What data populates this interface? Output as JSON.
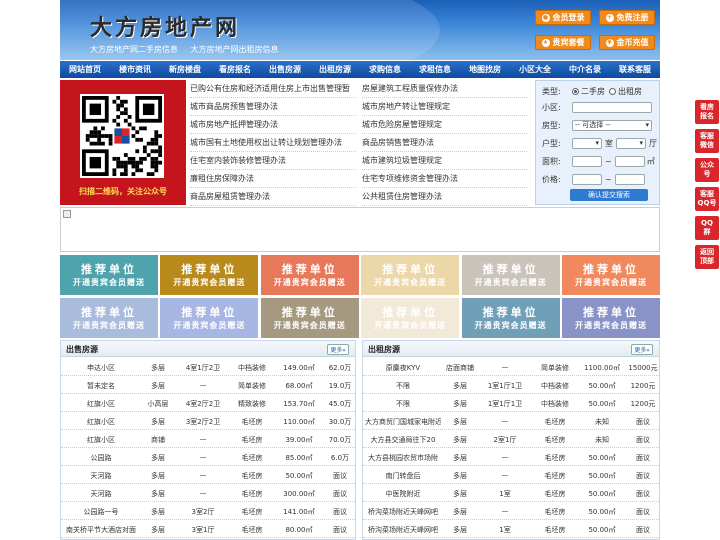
{
  "header": {
    "logo": "大方房地产网",
    "taglines": [
      "大方房地产网二手房信息",
      "大方房地产网出租房信息"
    ],
    "buttons": [
      "会员登录",
      "免费注册",
      "贵宾套餐",
      "金币充值"
    ]
  },
  "nav": [
    "网站首页",
    "楼市资讯",
    "新房楼盘",
    "看房报名",
    "出售房源",
    "出租房源",
    "求购信息",
    "求租信息",
    "地图找房",
    "小区大全",
    "中介名录",
    "联系客服"
  ],
  "qr": {
    "caption": "扫描二维码，关注公众号"
  },
  "links": {
    "left": [
      "已购公有住房和经济适用住房上市出售管理暂",
      "城市商品房预售管理办法",
      "城市房地产抵押管理办法",
      "城市国有土地使用权出让转让规划管理办法",
      "住宅室内装饰装修管理办法",
      "廉租住房保障办法",
      "商品房屋租赁管理办法"
    ],
    "right": [
      "房屋建筑工程质量保修办法",
      "城市房地产转让管理规定",
      "城市危险房屋管理规定",
      "商品房销售管理办法",
      "城市建筑垃圾管理规定",
      "住宅专项维修资金管理办法",
      "公共租赁住房管理办法"
    ]
  },
  "search": {
    "type_label": "类型:",
    "type_options": [
      "二手房",
      "出租房"
    ],
    "community_label": "小区:",
    "house_type_label": "房型:",
    "house_type_value": "-- 可选择 --",
    "layout_label": "户型:",
    "room_unit": "室",
    "hall_unit": "厅",
    "area_label": "面积:",
    "area_unit": "㎡",
    "price_label": "价格:",
    "range_sep": "~",
    "submit": "确认提交搜索"
  },
  "ads": {
    "line1": "推荐单位",
    "line2": "开通贵宾会员赠送",
    "colors": [
      "#4fa3ad",
      "#b88a1c",
      "#e8785a",
      "#ecd7a8",
      "#c9c3ba",
      "#f08a5e",
      "#a9bcdc",
      "#a8b6e4",
      "#a59a80",
      "#f3e9d9",
      "#6fa0b8",
      "#8a93c8"
    ]
  },
  "sale": {
    "title": "出售房源",
    "more": "更多»",
    "rows": [
      [
        "申达小区",
        "多层",
        "4室1厅2卫",
        "中档装修",
        "149.00㎡",
        "62.0万"
      ],
      [
        "暂未定名",
        "多层",
        "—",
        "简单装修",
        "68.00㎡",
        "19.0万"
      ],
      [
        "红旗小区",
        "小高层",
        "4室2厅2卫",
        "精致装修",
        "153.70㎡",
        "45.0万"
      ],
      [
        "红旗小区",
        "多层",
        "3室2厅2卫",
        "毛坯房",
        "110.00㎡",
        "30.0万"
      ],
      [
        "红旗小区",
        "商铺",
        "—",
        "毛坯房",
        "39.00㎡",
        "70.0万"
      ],
      [
        "公园路",
        "多层",
        "—",
        "毛坯房",
        "85.00㎡",
        "6.0万"
      ],
      [
        "天河路",
        "多层",
        "—",
        "毛坯房",
        "50.00㎡",
        "面议"
      ],
      [
        "天河路",
        "多层",
        "—",
        "毛坯房",
        "300.00㎡",
        "面议"
      ],
      [
        "公园路一号",
        "多层",
        "3室2厅",
        "毛坯房",
        "141.00㎡",
        "面议"
      ],
      [
        "南关桥平节大酒店对面",
        "多层",
        "3室1厅",
        "毛坯房",
        "80.00㎡",
        "面议"
      ]
    ]
  },
  "rent": {
    "title": "出租房源",
    "more": "更多»",
    "rows": [
      [
        "原麋夜KYV",
        "店面商铺",
        "—",
        "简单装修",
        "1100.00㎡",
        "15000元"
      ],
      [
        "不限",
        "多层",
        "1室1厅1卫",
        "中档装修",
        "50.00㎡",
        "1200元"
      ],
      [
        "不限",
        "多层",
        "1室1厅1卫",
        "中档装修",
        "50.00㎡",
        "1200元"
      ],
      [
        "大方商贸门国城家电附近",
        "多层",
        "—",
        "毛坯房",
        "未知",
        "面议"
      ],
      [
        "大方县交通局往下20",
        "多层",
        "2室1厅",
        "毛坯房",
        "未知",
        "面议"
      ],
      [
        "大方县桃园农贸市场附",
        "多层",
        "—",
        "毛坯房",
        "50.00㎡",
        "面议"
      ],
      [
        "南门转盘后",
        "多层",
        "—",
        "毛坯房",
        "50.00㎡",
        "面议"
      ],
      [
        "中医院附近",
        "多层",
        "1室",
        "毛坯房",
        "50.00㎡",
        "面议"
      ],
      [
        "桥沟菜场附近天峰网吧",
        "多层",
        "—",
        "毛坯房",
        "50.00㎡",
        "面议"
      ],
      [
        "桥沟菜场附近天峰网吧",
        "多层",
        "1室",
        "毛坯房",
        "50.00㎡",
        "面议"
      ]
    ]
  },
  "side": [
    [
      "看房",
      "报名"
    ],
    [
      "客服",
      "微信"
    ],
    [
      "公众",
      "号"
    ],
    [
      "客服",
      "QQ号"
    ],
    [
      "QQ",
      "群"
    ],
    [
      "返回",
      "顶部"
    ]
  ]
}
